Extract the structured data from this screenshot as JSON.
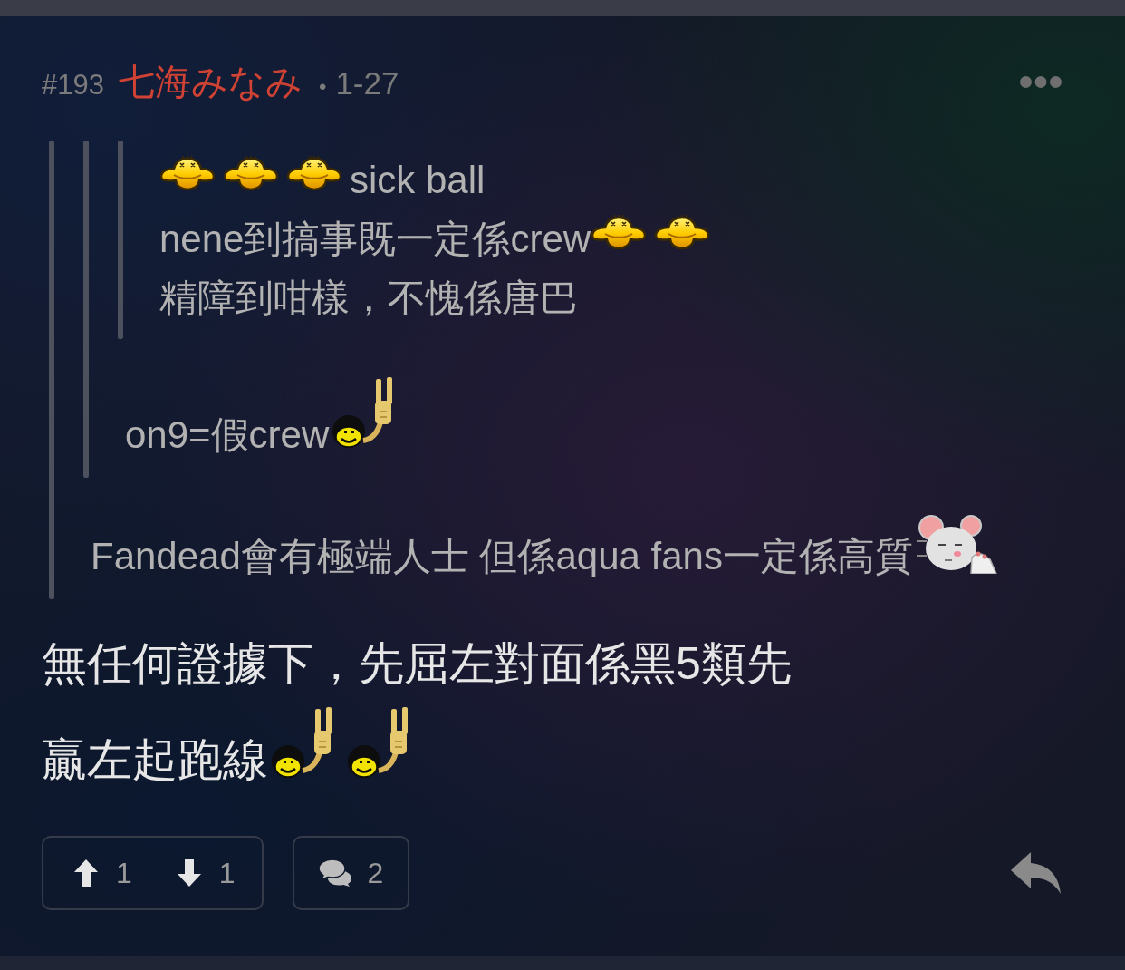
{
  "post": {
    "number": "#193",
    "author": "七海みなみ",
    "separator": "•",
    "date": "1-27"
  },
  "quote": {
    "quote": {
      "quote": {
        "lines": [
          {
            "segments": [
              {
                "kind": "sick"
              },
              {
                "kind": "sick"
              },
              {
                "kind": "sick"
              },
              {
                "kind": "text",
                "text": "sick ball"
              }
            ]
          },
          {
            "segments": [
              {
                "kind": "text",
                "text": "nene到搞事既一定係crew"
              },
              {
                "kind": "sick"
              },
              {
                "kind": "sick"
              }
            ]
          },
          {
            "segments": [
              {
                "kind": "text",
                "text": "精障到咁樣，不愧係唐巴"
              }
            ]
          }
        ]
      },
      "lines": [
        {
          "segments": [
            {
              "kind": "text",
              "text": "on9=假crew"
            },
            {
              "kind": "rock"
            }
          ]
        }
      ]
    },
    "lines": [
      {
        "segments": [
          {
            "kind": "text",
            "text": "Fandead會有極端人士 但係aqua fans一定係高質"
          },
          {
            "kind": "mouse"
          }
        ]
      }
    ]
  },
  "body": {
    "lines": [
      {
        "segments": [
          {
            "kind": "text",
            "text": "無任何證據下，先屈左對面係黑5類先"
          }
        ]
      },
      {
        "segments": [
          {
            "kind": "text",
            "text": "贏左起跑線"
          },
          {
            "kind": "rock"
          },
          {
            "kind": "rock"
          }
        ]
      }
    ]
  },
  "footer": {
    "upvotes": "1",
    "downvotes": "1",
    "comments": "2"
  }
}
